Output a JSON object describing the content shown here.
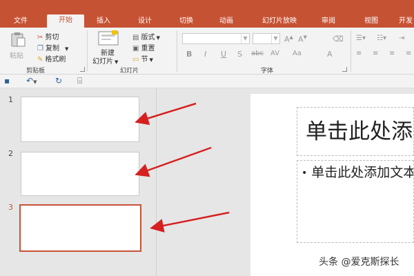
{
  "ribbon": {
    "tabs": [
      {
        "label": "文件",
        "active": false
      },
      {
        "label": "开始",
        "active": true
      },
      {
        "label": "插入",
        "active": false
      },
      {
        "label": "设计",
        "active": false
      },
      {
        "label": "切换",
        "active": false
      },
      {
        "label": "动画",
        "active": false
      },
      {
        "label": "幻灯片放映",
        "active": false
      },
      {
        "label": "审阅",
        "active": false
      },
      {
        "label": "视图",
        "active": false
      },
      {
        "label": "开发",
        "active": false
      }
    ],
    "clipboard": {
      "paste": "粘贴",
      "cut": "剪切",
      "copy": "复制",
      "format_painter": "格式刷",
      "group_label": "剪贴板"
    },
    "slides": {
      "new_slide_line1": "新建",
      "new_slide_line2": "幻灯片",
      "layout": "版式",
      "reset": "重置",
      "section": "节",
      "group_label": "幻灯片"
    },
    "font": {
      "group_label": "字体",
      "bold": "B",
      "italic": "I",
      "underline": "U",
      "shadow": "S",
      "strike": "abc",
      "spacing": "AV",
      "case": "Aa",
      "color": "A"
    }
  },
  "slides": [
    {
      "number": "1",
      "selected": false
    },
    {
      "number": "2",
      "selected": false
    },
    {
      "number": "3",
      "selected": true
    }
  ],
  "canvas": {
    "title_placeholder": "单击此处添加标题",
    "body_placeholder": "单击此处添加文本"
  },
  "watermark": "头条 @爱克斯探长",
  "colors": {
    "accent": "#c65234",
    "arrow": "#d62020"
  }
}
